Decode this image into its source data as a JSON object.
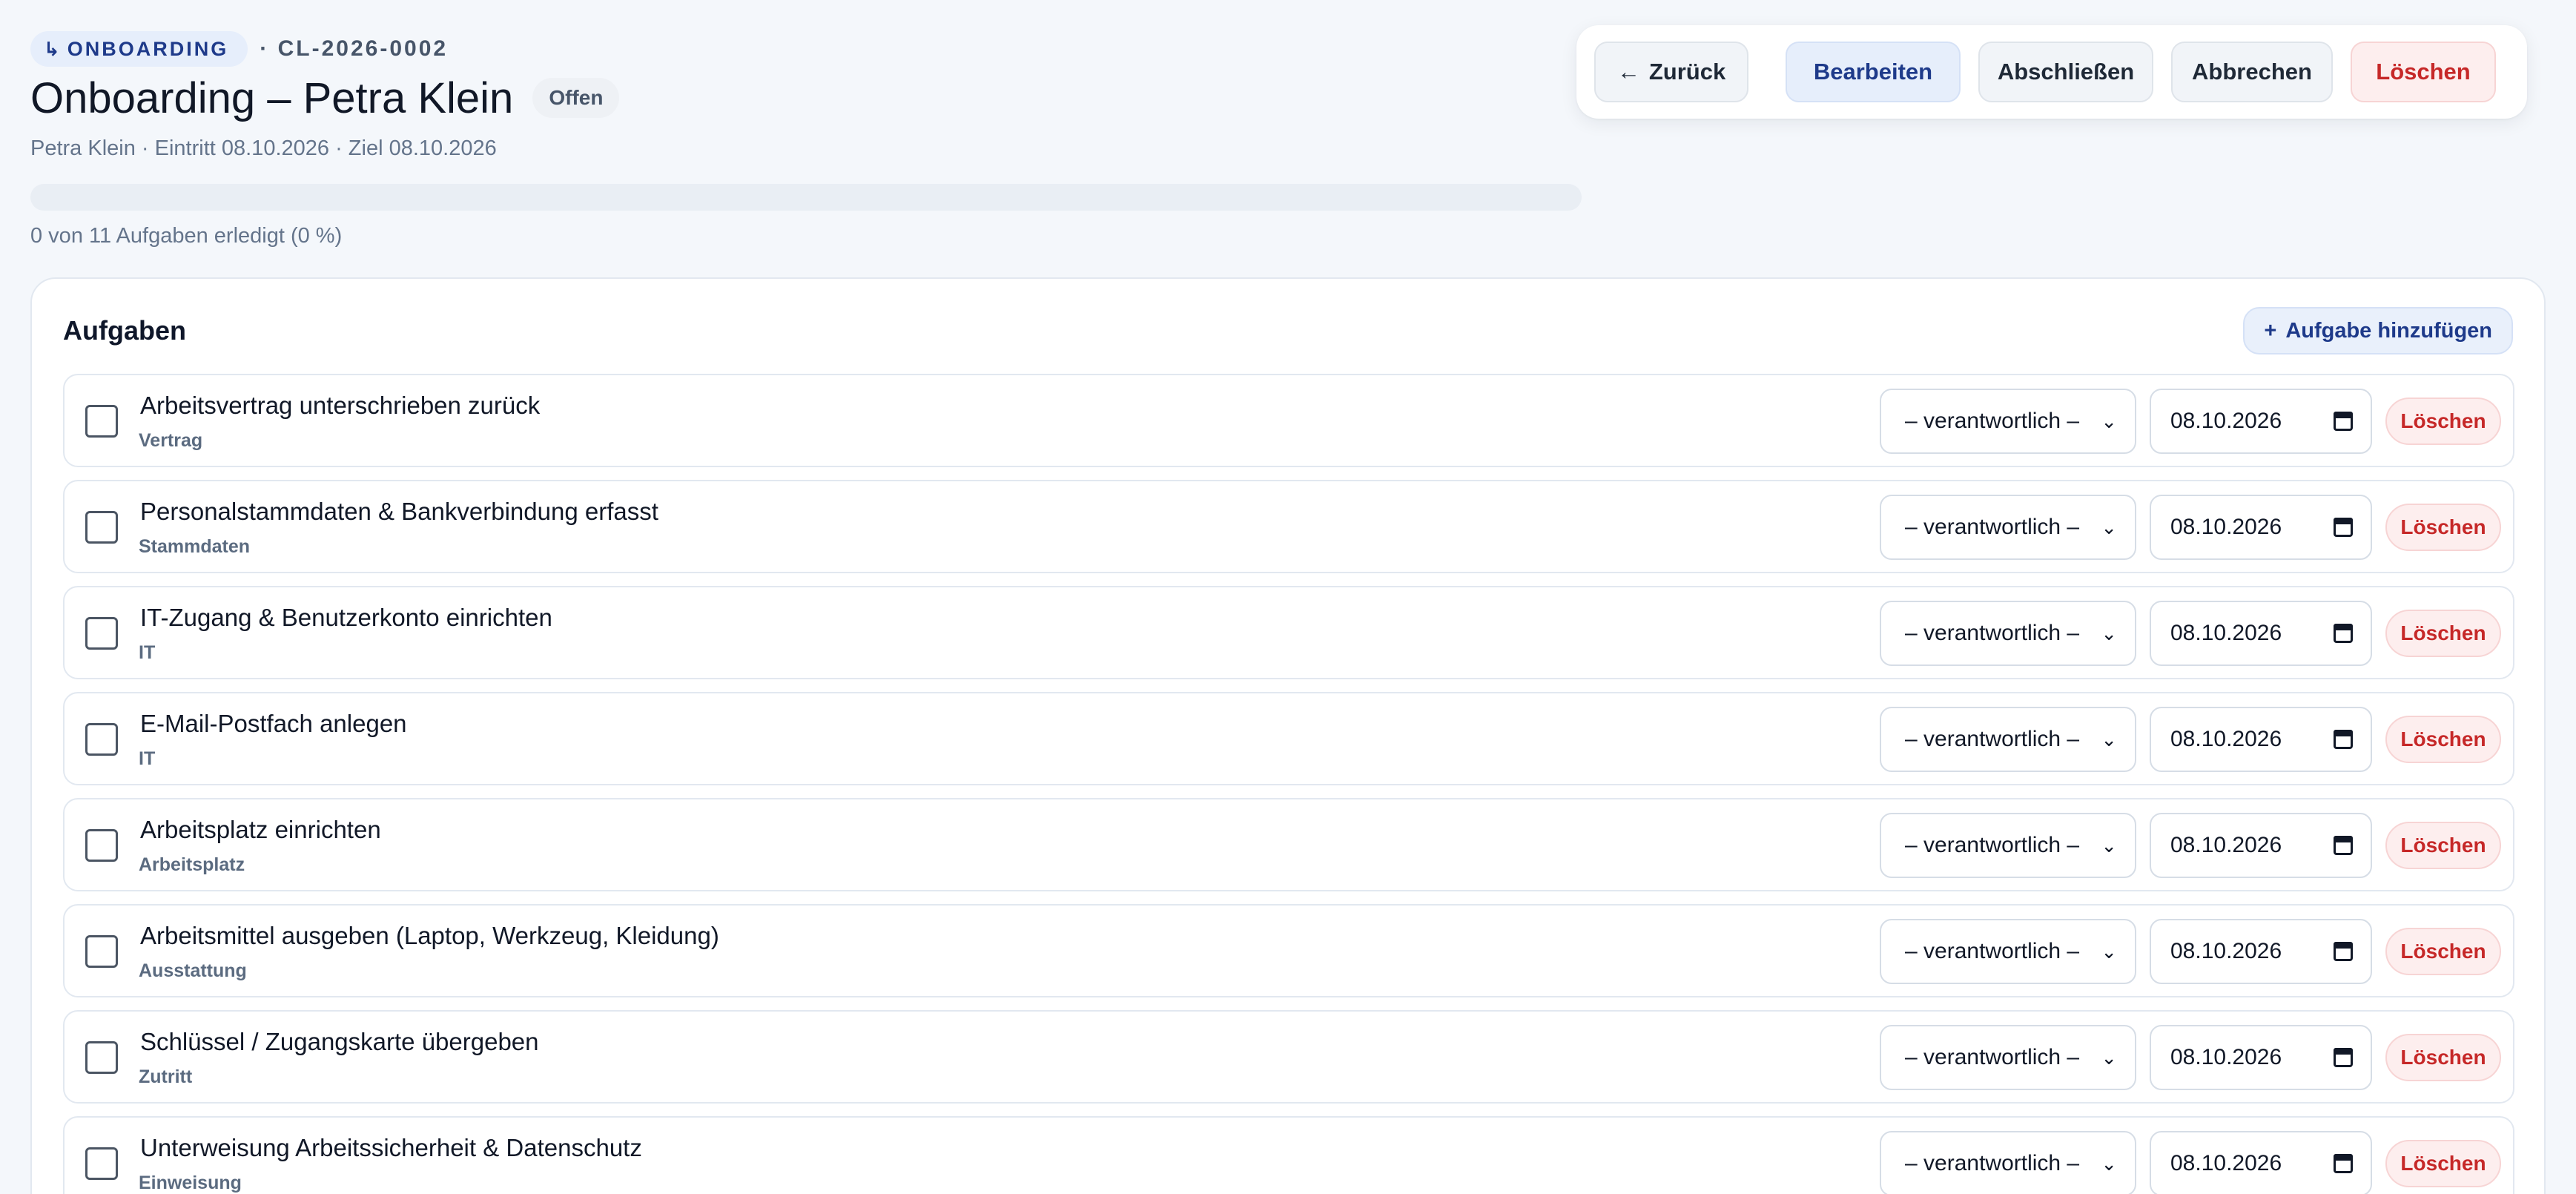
{
  "header": {
    "kind": "ONBOARDING",
    "case_id": "· CL-2026-0002",
    "title": "Onboarding – Petra Klein",
    "status": "Offen",
    "subtitle": "Petra Klein · Eintritt 08.10.2026 · Ziel 08.10.2026",
    "progress_percent": 0,
    "progress_text": "0 von 11 Aufgaben erledigt (0 %)"
  },
  "toolbar": {
    "back_label": "Zurück",
    "edit_label": "Bearbeiten",
    "complete_label": "Abschließen",
    "cancel_label": "Abbrechen",
    "delete_label": "Löschen"
  },
  "tasks_card": {
    "title": "Aufgaben",
    "add_label": "Aufgabe hinzufügen",
    "assignee_placeholder": "– verantwortlich –",
    "row_delete_label": "Löschen",
    "tasks": [
      {
        "title": "Arbeitsvertrag unterschrieben zurück",
        "category": "Vertrag",
        "due": "08.10.2026",
        "done": false
      },
      {
        "title": "Personalstammdaten & Bankverbindung erfasst",
        "category": "Stammdaten",
        "due": "08.10.2026",
        "done": false
      },
      {
        "title": "IT-Zugang & Benutzerkonto einrichten",
        "category": "IT",
        "due": "08.10.2026",
        "done": false
      },
      {
        "title": "E-Mail-Postfach anlegen",
        "category": "IT",
        "due": "08.10.2026",
        "done": false
      },
      {
        "title": "Arbeitsplatz einrichten",
        "category": "Arbeitsplatz",
        "due": "08.10.2026",
        "done": false
      },
      {
        "title": "Arbeitsmittel ausgeben (Laptop, Werkzeug, Kleidung)",
        "category": "Ausstattung",
        "due": "08.10.2026",
        "done": false
      },
      {
        "title": "Schlüssel / Zugangskarte übergeben",
        "category": "Zutritt",
        "due": "08.10.2026",
        "done": false
      },
      {
        "title": "Unterweisung Arbeitssicherheit & Datenschutz",
        "category": "Einweisung",
        "due": "08.10.2026",
        "done": false
      }
    ]
  },
  "colors": {
    "accent": "#1e3a8a",
    "danger": "#c62828",
    "background": "#f4f7fb"
  }
}
